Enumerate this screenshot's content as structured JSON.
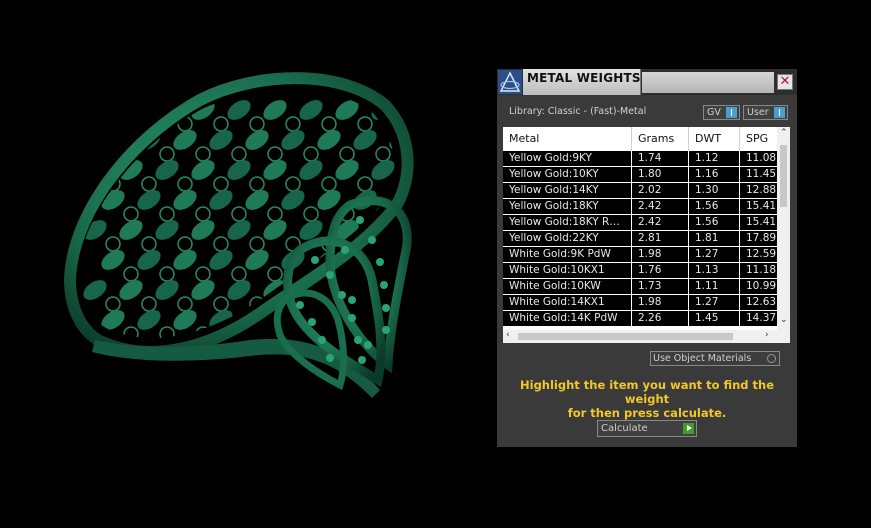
{
  "panel": {
    "title": "METAL WEIGHTS",
    "close_glyph": "✕",
    "library_label": "Library: Classic - (Fast)-Metal",
    "gv_toggle_label": "GV",
    "user_toggle_label": "User",
    "use_object_materials_label": "Use Object Materials",
    "hint_line1": "Highlight the item you want to find the weight",
    "hint_line2": "for then press calculate.",
    "calculate_label": "Calculate"
  },
  "table": {
    "columns": [
      "Metal",
      "Grams",
      "DWT",
      "SPG"
    ],
    "rows": [
      [
        "Yellow Gold:9KY",
        "1.74",
        "1.12",
        "11.08"
      ],
      [
        "Yellow Gold:10KY",
        "1.80",
        "1.16",
        "11.45"
      ],
      [
        "Yellow Gold:14KY",
        "2.02",
        "1.30",
        "12.88"
      ],
      [
        "Yellow Gold:18KY",
        "2.42",
        "1.56",
        "15.41"
      ],
      [
        "Yellow Gold:18KY R…",
        "2.42",
        "1.56",
        "15.41"
      ],
      [
        "Yellow Gold:22KY",
        "2.81",
        "1.81",
        "17.89"
      ],
      [
        "White Gold:9K PdW",
        "1.98",
        "1.27",
        "12.59"
      ],
      [
        "White Gold:10KX1",
        "1.76",
        "1.13",
        "11.18"
      ],
      [
        "White Gold:10KW",
        "1.73",
        "1.11",
        "10.99"
      ],
      [
        "White Gold:14KX1",
        "1.98",
        "1.27",
        "12.63"
      ],
      [
        "White Gold:14K PdW",
        "2.26",
        "1.45",
        "14.37"
      ]
    ]
  },
  "colors": {
    "ring_green": "#1f7a5a",
    "hint_yellow": "#f2c72a",
    "toggle_blue": "#4aa0c8",
    "calc_green": "#3f9e2a"
  },
  "icons": {
    "app_logo": "app-logo-icon",
    "close": "close-icon",
    "scroll_up": "chevron-up-icon",
    "scroll_down": "chevron-down-icon",
    "scroll_left": "chevron-left-icon",
    "scroll_right": "chevron-right-icon",
    "calculate": "play-icon"
  }
}
